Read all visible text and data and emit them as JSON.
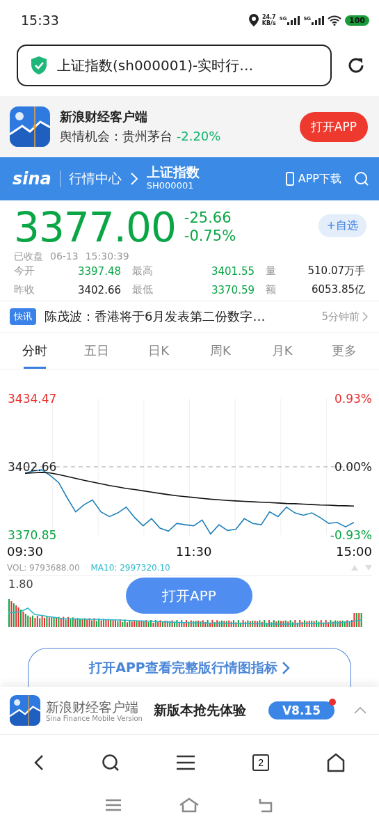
{
  "status_bar": {
    "time": "15:33",
    "speed": "24.7",
    "speed_unit": "KB/s",
    "networks": [
      "5G",
      "5G"
    ],
    "battery": "100"
  },
  "address_bar": {
    "title": "上证指数(sh000001)-实时行…"
  },
  "app_banner": {
    "name": "新浪财经客户端",
    "promo_label": "舆情机会：贵州茅台",
    "promo_change": "-2.20%",
    "button": "打开APP"
  },
  "header": {
    "logo": "sina",
    "section": "行情中心",
    "stock_name": "上证指数",
    "stock_code": "SH000001",
    "download": "APP下载"
  },
  "quote": {
    "price": "3377.00",
    "change": "-25.66",
    "change_pct": "-0.75%",
    "color": "#0aa545",
    "watch_button": "+自选",
    "status": "已收盘",
    "date": "06-13",
    "time": "15:30:39"
  },
  "stats": [
    {
      "label": "今开",
      "value": "3397.48",
      "color": "#0aa545"
    },
    {
      "label": "最高",
      "value": "3401.55",
      "color": "#0aa545"
    },
    {
      "label": "量",
      "value": "510.07万手",
      "color": "#222222"
    },
    {
      "label": "昨收",
      "value": "3402.66",
      "color": "#222222"
    },
    {
      "label": "最低",
      "value": "3370.59",
      "color": "#0aa545"
    },
    {
      "label": "额",
      "value": "6053.85亿",
      "color": "#222222"
    }
  ],
  "news": {
    "badge": "快讯",
    "headline": "陈茂波：香港将于6月发表第二份数字…",
    "time": "5分钟前"
  },
  "tabs": [
    {
      "label": "分时",
      "selected": true
    },
    {
      "label": "五日",
      "selected": false
    },
    {
      "label": "日K",
      "selected": false
    },
    {
      "label": "周K",
      "selected": false
    },
    {
      "label": "月K",
      "selected": false
    },
    {
      "label": "更多",
      "selected": false
    }
  ],
  "chart": {
    "chart_data": {
      "type": "line",
      "categories": [
        "09:30",
        null,
        null,
        null,
        null,
        null,
        null,
        null,
        null,
        null,
        null,
        null,
        null,
        null,
        null,
        null,
        null,
        null,
        null,
        null,
        "11:30",
        null,
        null,
        null,
        null,
        null,
        null,
        null,
        null,
        null,
        null,
        null,
        null,
        null,
        null,
        null,
        null,
        null,
        null,
        "15:00"
      ],
      "ylim": [
        3370.85,
        3434.47
      ],
      "yticks": [
        {
          "value": 3434.47,
          "label": "3434.47"
        },
        {
          "value": 3402.66,
          "label": "3402.66"
        },
        {
          "value": 3370.85,
          "label": "3370.85"
        }
      ],
      "series": [
        {
          "color": "#1f7fb8",
          "values": [
            3399.7,
            3400.8,
            3401.3,
            3398.6,
            3395.3,
            3388.2,
            3381.7,
            3385.0,
            3387.2,
            3381.7,
            3379.5,
            3381.2,
            3383.9,
            3379.0,
            3375.2,
            3378.5,
            3374.1,
            3372.7,
            3376.3,
            3375.7,
            3375.2,
            3377.9,
            3371.4,
            3375.7,
            3373.0,
            3373.6,
            3378.5,
            3376.3,
            3375.7,
            3381.7,
            3379.5,
            3383.9,
            3381.2,
            3380.1,
            3381.2,
            3379.0,
            3376.3,
            3376.8,
            3374.7,
            3376.8
          ]
        },
        {
          "color": "#111111",
          "values": [
            3399.7,
            3399.9,
            3400.1,
            3399.8,
            3399.1,
            3398.2,
            3397.3,
            3396.4,
            3395.6,
            3394.8,
            3394.0,
            3393.3,
            3392.6,
            3392.1,
            3391.5,
            3390.9,
            3390.3,
            3389.7,
            3389.2,
            3388.8,
            3388.4,
            3388.0,
            3387.6,
            3387.3,
            3387.0,
            3386.8,
            3386.6,
            3386.4,
            3386.2,
            3386.0,
            3385.8,
            3385.6,
            3385.5,
            3385.3,
            3385.1,
            3384.9,
            3384.8,
            3384.6,
            3384.5,
            3384.4
          ]
        },
        {
          "color": "#aaaaaa",
          "line_style": "dashed",
          "values": [
            3402.7,
            3402.7,
            3402.7,
            3402.7,
            3402.7,
            3402.7,
            3402.7,
            3402.7,
            3402.7,
            3402.7,
            3402.7,
            3402.7,
            3402.7,
            3402.7,
            3402.7,
            3402.7,
            3402.7,
            3402.7,
            3402.7,
            3402.7,
            3402.7,
            3402.7,
            3402.7,
            3402.7,
            3402.7,
            3402.7,
            3402.7,
            3402.7,
            3402.7,
            3402.7,
            3402.7,
            3402.7,
            3402.7,
            3402.7,
            3402.7,
            3402.7,
            3402.7,
            3402.7,
            3402.7,
            3402.7
          ]
        }
      ]
    },
    "pct_labels": [
      {
        "text": "0.93%",
        "color": "#e8302f"
      },
      {
        "text": "0.00%",
        "color": "#222222"
      },
      {
        "text": "-0.93%",
        "color": "#0aa545"
      }
    ],
    "vol_label": "VOL: 9793688.00",
    "ma_label": "MA10: 2997320.10",
    "vol_scale": "1.80",
    "open_button": "打开APP"
  },
  "full_chart_button": "打开APP查看完整版行情图指标",
  "bottom_banner": {
    "name": "新浪财经客户端",
    "subtitle": "Sina Finance Mobile Version",
    "slogan": "新版本抢先体验",
    "version": "V8.15",
    "has_dot": true
  },
  "browser_nav": {
    "tab_count": "2"
  }
}
